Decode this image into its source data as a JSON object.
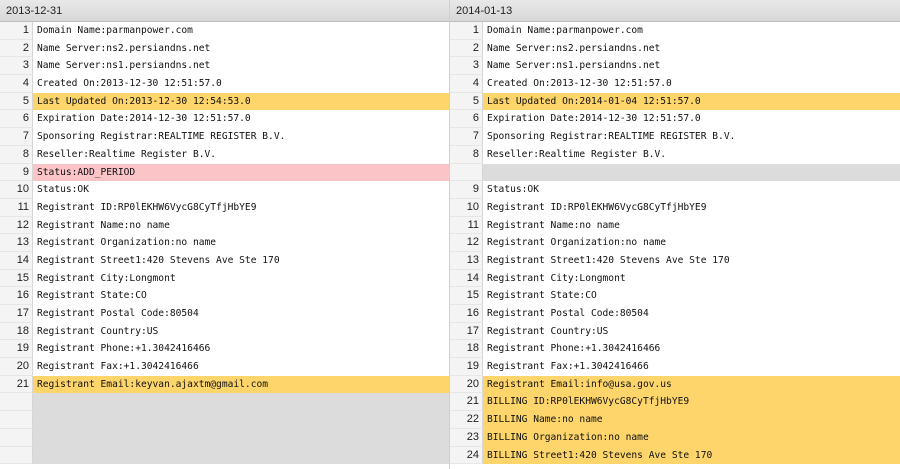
{
  "left": {
    "title": "2013-12-31",
    "rows": [
      {
        "num": "1",
        "text": "Domain Name:parmanpower.com",
        "state": "normal"
      },
      {
        "num": "2",
        "text": "Name Server:ns2.persiandns.net",
        "state": "normal"
      },
      {
        "num": "3",
        "text": "Name Server:ns1.persiandns.net",
        "state": "normal"
      },
      {
        "num": "4",
        "text": "Created On:2013-12-30 12:51:57.0",
        "state": "normal"
      },
      {
        "num": "5",
        "text": "Last Updated On:2013-12-30 12:54:53.0",
        "state": "changed"
      },
      {
        "num": "6",
        "text": "Expiration Date:2014-12-30 12:51:57.0",
        "state": "normal"
      },
      {
        "num": "7",
        "text": "Sponsoring Registrar:REALTIME REGISTER B.V.",
        "state": "normal"
      },
      {
        "num": "8",
        "text": "Reseller:Realtime Register B.V.",
        "state": "normal"
      },
      {
        "num": "9",
        "text": "Status:ADD_PERIOD",
        "state": "removed"
      },
      {
        "num": "10",
        "text": "Status:OK",
        "state": "normal"
      },
      {
        "num": "11",
        "text": "Registrant ID:RP0lEKHW6VycG8CyTfjHbYE9",
        "state": "normal"
      },
      {
        "num": "12",
        "text": "Registrant Name:no name",
        "state": "normal"
      },
      {
        "num": "13",
        "text": "Registrant Organization:no name",
        "state": "normal"
      },
      {
        "num": "14",
        "text": "Registrant Street1:420 Stevens Ave Ste 170",
        "state": "normal"
      },
      {
        "num": "15",
        "text": "Registrant City:Longmont",
        "state": "normal"
      },
      {
        "num": "16",
        "text": "Registrant State:CO",
        "state": "normal"
      },
      {
        "num": "17",
        "text": "Registrant Postal Code:80504",
        "state": "normal"
      },
      {
        "num": "18",
        "text": "Registrant Country:US",
        "state": "normal"
      },
      {
        "num": "19",
        "text": "Registrant Phone:+1.3042416466",
        "state": "normal"
      },
      {
        "num": "20",
        "text": "Registrant Fax:+1.3042416466",
        "state": "normal"
      },
      {
        "num": "21",
        "text": "Registrant Email:keyvan.ajaxtm@gmail.com",
        "state": "changed"
      },
      {
        "num": "",
        "text": "",
        "state": "filler"
      },
      {
        "num": "",
        "text": "",
        "state": "filler"
      },
      {
        "num": "",
        "text": "",
        "state": "filler"
      },
      {
        "num": "",
        "text": "",
        "state": "filler"
      }
    ]
  },
  "right": {
    "title": "2014-01-13",
    "rows": [
      {
        "num": "1",
        "text": "Domain Name:parmanpower.com",
        "state": "normal"
      },
      {
        "num": "2",
        "text": "Name Server:ns2.persiandns.net",
        "state": "normal"
      },
      {
        "num": "3",
        "text": "Name Server:ns1.persiandns.net",
        "state": "normal"
      },
      {
        "num": "4",
        "text": "Created On:2013-12-30 12:51:57.0",
        "state": "normal"
      },
      {
        "num": "5",
        "text": "Last Updated On:2014-01-04 12:51:57.0",
        "state": "changed"
      },
      {
        "num": "6",
        "text": "Expiration Date:2014-12-30 12:51:57.0",
        "state": "normal"
      },
      {
        "num": "7",
        "text": "Sponsoring Registrar:REALTIME REGISTER B.V.",
        "state": "normal"
      },
      {
        "num": "8",
        "text": "Reseller:Realtime Register B.V.",
        "state": "normal"
      },
      {
        "num": "",
        "text": "",
        "state": "filler"
      },
      {
        "num": "9",
        "text": "Status:OK",
        "state": "normal"
      },
      {
        "num": "10",
        "text": "Registrant ID:RP0lEKHW6VycG8CyTfjHbYE9",
        "state": "normal"
      },
      {
        "num": "11",
        "text": "Registrant Name:no name",
        "state": "normal"
      },
      {
        "num": "12",
        "text": "Registrant Organization:no name",
        "state": "normal"
      },
      {
        "num": "13",
        "text": "Registrant Street1:420 Stevens Ave Ste 170",
        "state": "normal"
      },
      {
        "num": "14",
        "text": "Registrant City:Longmont",
        "state": "normal"
      },
      {
        "num": "15",
        "text": "Registrant State:CO",
        "state": "normal"
      },
      {
        "num": "16",
        "text": "Registrant Postal Code:80504",
        "state": "normal"
      },
      {
        "num": "17",
        "text": "Registrant Country:US",
        "state": "normal"
      },
      {
        "num": "18",
        "text": "Registrant Phone:+1.3042416466",
        "state": "normal"
      },
      {
        "num": "19",
        "text": "Registrant Fax:+1.3042416466",
        "state": "normal"
      },
      {
        "num": "20",
        "text": "Registrant Email:info@usa.gov.us",
        "state": "changed"
      },
      {
        "num": "21",
        "text": "BILLING ID:RP0lEKHW6VycG8CyTfjHbYE9",
        "state": "changed"
      },
      {
        "num": "22",
        "text": "BILLING Name:no name",
        "state": "changed"
      },
      {
        "num": "23",
        "text": "BILLING Organization:no name",
        "state": "changed"
      },
      {
        "num": "24",
        "text": "BILLING Street1:420 Stevens Ave Ste 170",
        "state": "changed"
      }
    ]
  }
}
